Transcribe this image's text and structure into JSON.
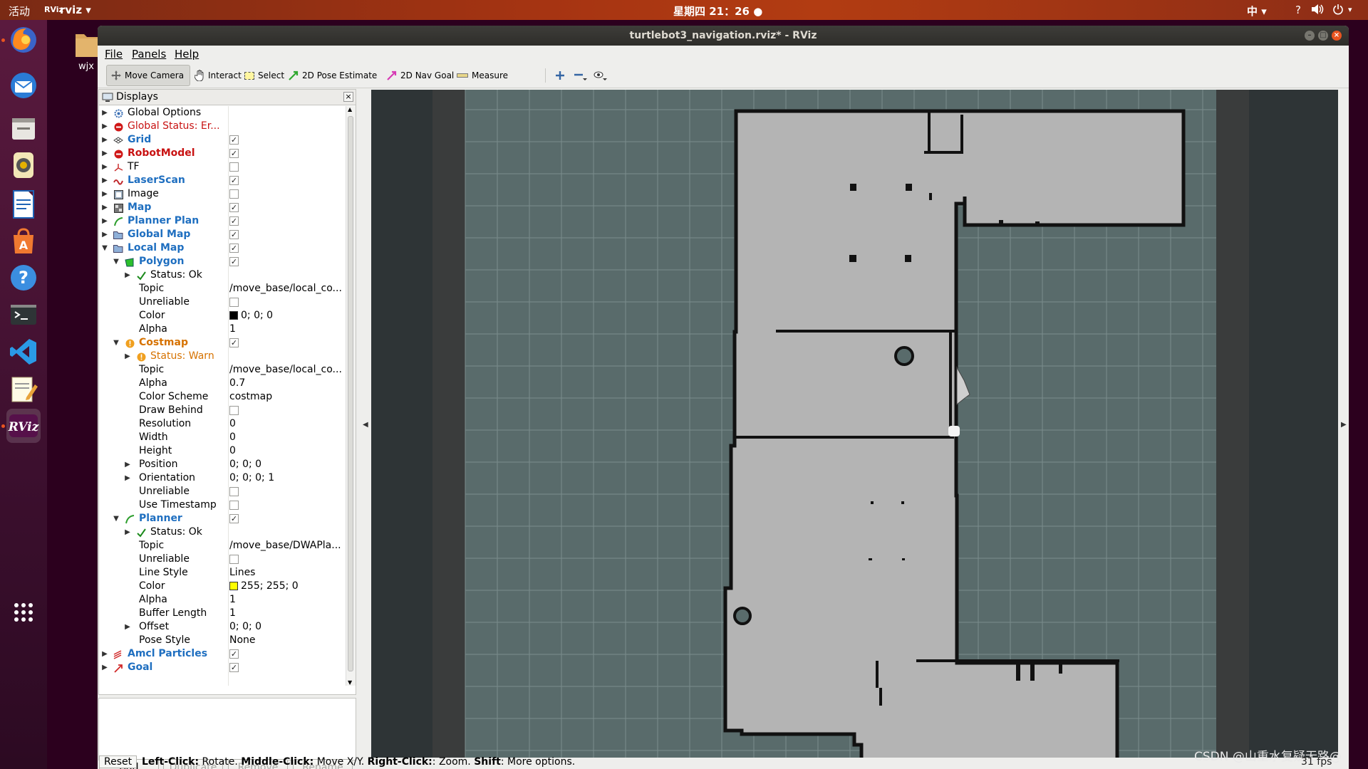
{
  "topbar": {
    "activities": "活动",
    "app_icon": "RViz",
    "app_menu": "rviz ▾",
    "clock": "星期四 21：26 ●",
    "input_method": "中 ▾",
    "help": "?",
    "volume_icon": "speaker-icon",
    "power_icon": "power-icon"
  },
  "dock": {
    "items": [
      "firefox-icon",
      "thunderbird-icon",
      "files-icon",
      "rhythmbox-icon",
      "writer-icon",
      "software-center-icon",
      "help-icon",
      "terminal-icon",
      "vscode-icon",
      "text-editor-icon",
      "rviz-icon"
    ],
    "apps_grid": "show-applications-icon"
  },
  "desktop": {
    "file_label": "wjx"
  },
  "window": {
    "title": "turtlebot3_navigation.rviz* - RViz"
  },
  "menu": {
    "file": "File",
    "panels": "Panels",
    "help": "Help"
  },
  "toolbar": {
    "move_camera": "Move Camera",
    "interact": "Interact",
    "select": "Select",
    "pose_estimate": "2D Pose Estimate",
    "nav_goal": "2D Nav Goal",
    "measure": "Measure"
  },
  "displays": {
    "header": "Displays",
    "rows": {
      "global_options": "Global Options",
      "global_status": "Global Status: Er...",
      "grid": "Grid",
      "robot_model": "RobotModel",
      "tf": "TF",
      "laser_scan": "LaserScan",
      "image": "Image",
      "map": "Map",
      "planner_plan": "Planner Plan",
      "global_map": "Global Map",
      "local_map": "Local Map",
      "polygon": "Polygon",
      "polygon_status": "Status: Ok",
      "polygon_topic_label": "Topic",
      "polygon_topic": "/move_base/local_co...",
      "polygon_unreliable": "Unreliable",
      "polygon_color_label": "Color",
      "polygon_color": "0; 0; 0",
      "polygon_alpha_label": "Alpha",
      "polygon_alpha": "1",
      "costmap": "Costmap",
      "costmap_status": "Status: Warn",
      "costmap_topic_label": "Topic",
      "costmap_topic": "/move_base/local_co...",
      "costmap_alpha_label": "Alpha",
      "costmap_alpha": "0.7",
      "color_scheme_label": "Color Scheme",
      "color_scheme": "costmap",
      "draw_behind": "Draw Behind",
      "resolution_label": "Resolution",
      "resolution": "0",
      "width_label": "Width",
      "width": "0",
      "height_label": "Height",
      "height": "0",
      "position_label": "Position",
      "position": "0; 0; 0",
      "orientation_label": "Orientation",
      "orientation": "0; 0; 0; 1",
      "costmap_unreliable": "Unreliable",
      "use_timestamp": "Use Timestamp",
      "planner": "Planner",
      "planner_status": "Status: Ok",
      "planner_topic_label": "Topic",
      "planner_topic": "/move_base/DWAPla...",
      "planner_unreliable": "Unreliable",
      "line_style_label": "Line Style",
      "line_style": "Lines",
      "planner_color_label": "Color",
      "planner_color": "255; 255; 0",
      "planner_alpha_label": "Alpha",
      "planner_alpha": "1",
      "buffer_length_label": "Buffer Length",
      "buffer_length": "1",
      "offset_label": "Offset",
      "offset": "0; 0; 0",
      "pose_style_label": "Pose Style",
      "pose_style": "None",
      "amcl_particles": "Amcl Particles",
      "goal": "Goal"
    },
    "swatches": {
      "polygon": "#000000",
      "planner": "#ffff00"
    },
    "buttons": {
      "add": "Add",
      "duplicate": "Duplicate",
      "remove": "Remove",
      "rename": "Rename"
    }
  },
  "status": {
    "reset": "Reset",
    "left_click": "Left-Click:",
    "left_click_desc": " Rotate. ",
    "middle_click": "Middle-Click:",
    "middle_click_desc": " Move X/Y. ",
    "right_click": "Right-Click:",
    "right_click_desc": ": Zoom. ",
    "shift": "Shift",
    "shift_desc": ": More options.",
    "fps": "31 fps"
  },
  "watermark": "CSDN @山重水复疑无路@",
  "colors": {
    "accent": "#e95420",
    "map_free": "#b4b4b4",
    "map_unknown": "#596b6b",
    "map_wall": "#111111",
    "viewport_bg": "#2e3436",
    "grid_line": "#7a8c8c"
  }
}
